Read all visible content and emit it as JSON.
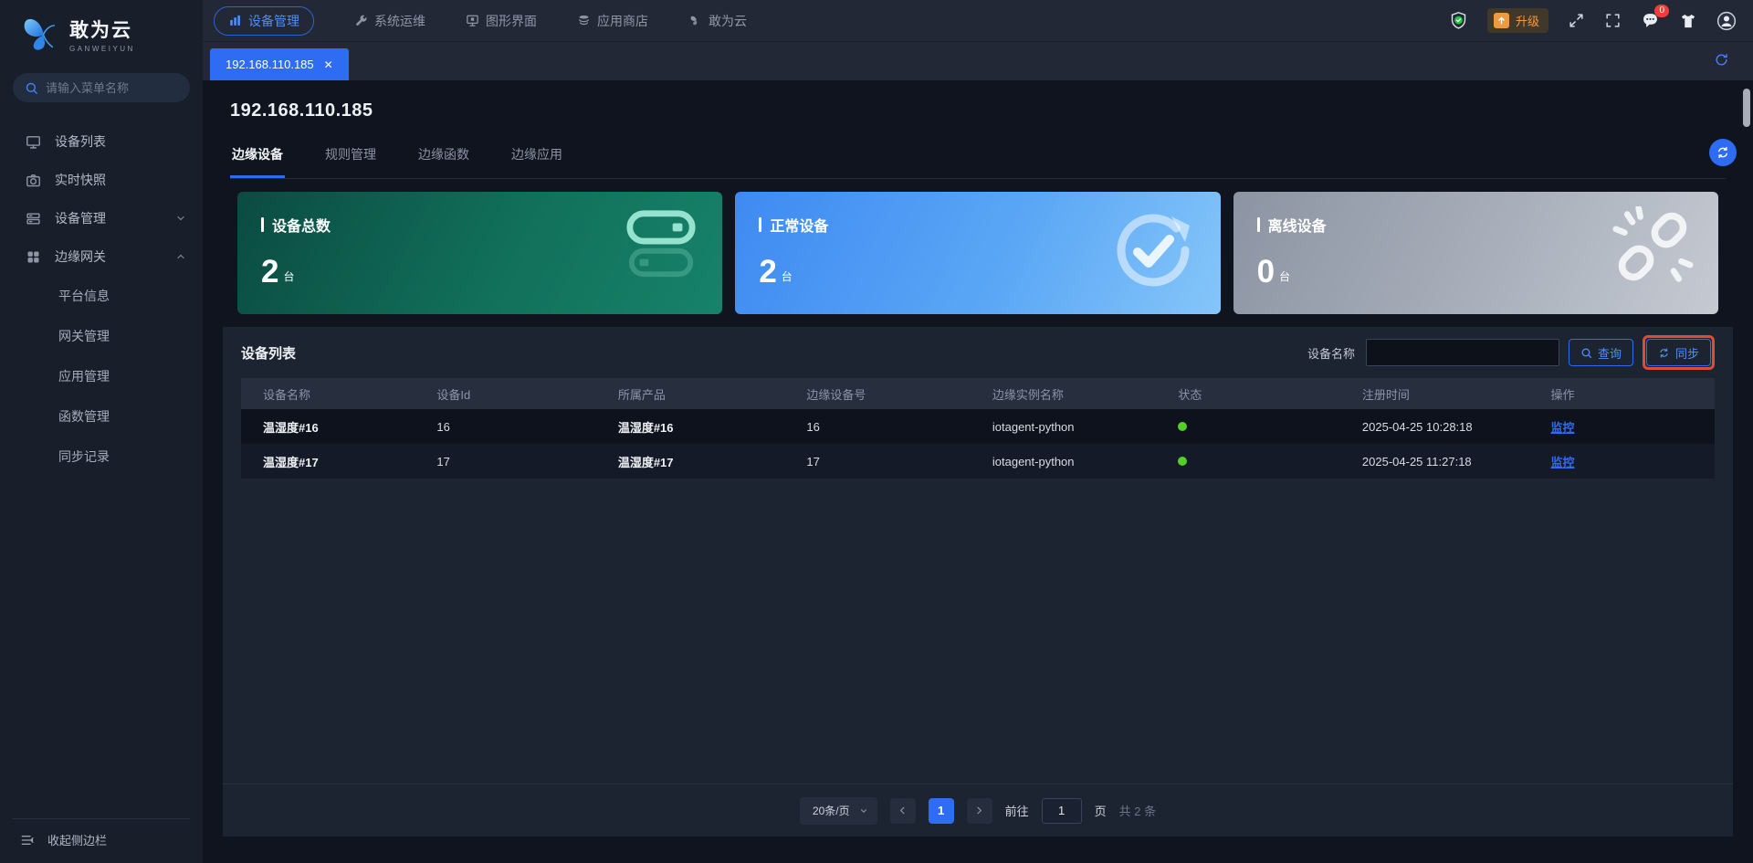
{
  "brand": {
    "name": "敢为云",
    "subtitle": "GANWEIYUN"
  },
  "topnav": {
    "items": [
      {
        "label": "设备管理"
      },
      {
        "label": "系统运维"
      },
      {
        "label": "图形界面"
      },
      {
        "label": "应用商店"
      },
      {
        "label": "敢为云"
      }
    ],
    "upgrade_label": "升级",
    "message_badge": "0"
  },
  "sidebar": {
    "search_placeholder": "请输入菜单名称",
    "items": [
      {
        "label": "设备列表"
      },
      {
        "label": "实时快照"
      },
      {
        "label": "设备管理"
      },
      {
        "label": "边缘网关"
      }
    ],
    "submenu": [
      "平台信息",
      "网关管理",
      "应用管理",
      "函数管理",
      "同步记录"
    ],
    "collapse_label": "收起侧边栏"
  },
  "tabbar": {
    "tab": "192.168.110.185"
  },
  "page": {
    "title": "192.168.110.185",
    "tabs": [
      {
        "label": "边缘设备"
      },
      {
        "label": "规则管理"
      },
      {
        "label": "边缘函数"
      },
      {
        "label": "边缘应用"
      }
    ]
  },
  "cards": [
    {
      "title": "设备总数",
      "value": "2",
      "unit": "台"
    },
    {
      "title": "正常设备",
      "value": "2",
      "unit": "台"
    },
    {
      "title": "离线设备",
      "value": "0",
      "unit": "台"
    }
  ],
  "device_list": {
    "title": "设备列表",
    "search_label": "设备名称",
    "query_label": "查询",
    "sync_label": "同步",
    "columns": [
      "设备名称",
      "设备Id",
      "所属产品",
      "边缘设备号",
      "边缘实例名称",
      "状态",
      "注册时间",
      "操作"
    ],
    "rows": [
      {
        "name": "温湿度#16",
        "id": "16",
        "product": "温湿度#16",
        "edge_no": "16",
        "instance": "iotagent-python",
        "time": "2025-04-25 10:28:18",
        "action": "监控"
      },
      {
        "name": "温湿度#17",
        "id": "17",
        "product": "温湿度#17",
        "edge_no": "17",
        "instance": "iotagent-python",
        "time": "2025-04-25 11:27:18",
        "action": "监控"
      }
    ]
  },
  "pagination": {
    "page_size": "20条/页",
    "current": "1",
    "goto_label": "前往",
    "goto_value": "1",
    "page_label": "页",
    "total": "共 2 条"
  },
  "colors": {
    "accent": "#2e6bf3",
    "online_dot": "#53cf27",
    "highlight_box": "#e04b35",
    "upgrade_orange": "#f09a3f"
  }
}
